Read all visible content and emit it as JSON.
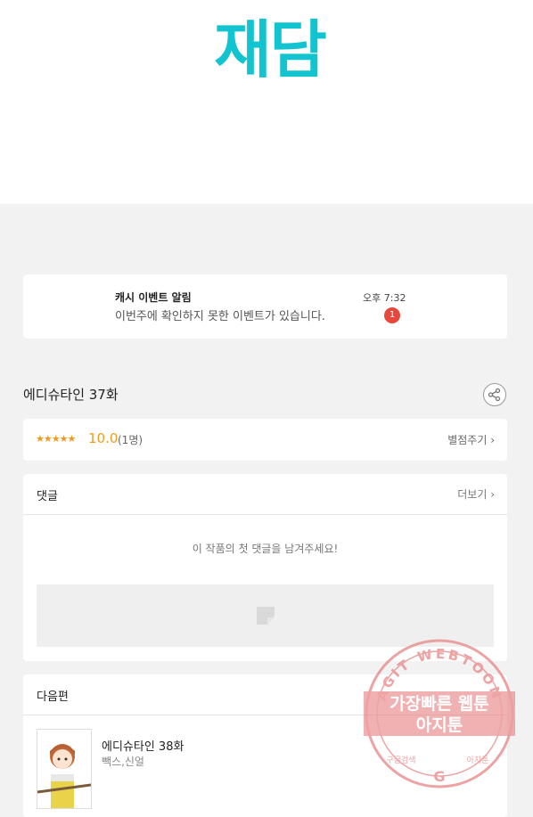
{
  "logo": {
    "text": "재담"
  },
  "notification": {
    "title": "캐시 이벤트 알림",
    "message": "이번주에 확인하지 못한 이벤트가 있습니다.",
    "time": "오후 7:32",
    "badge": "1"
  },
  "episode": {
    "title": "에디슈타인 37화",
    "share_icon": "share-icon"
  },
  "rating": {
    "stars": "★★★★★",
    "score": "10.0",
    "count": "(1명)",
    "rate_link": "별점주기 ›"
  },
  "comments": {
    "header": "댓글",
    "more": "더보기 ›",
    "empty_message": "이 작품의 첫 댓글을 남겨주세요!"
  },
  "next": {
    "header": "다음편",
    "title": "에디슈타인 38화",
    "authors": "빽스,신얼"
  },
  "watermark": {
    "arc_text": "AGIT WEBTOON",
    "line1": "가장빠른 웹툰",
    "line2": "아지툰",
    "bottom_left": "구글검색",
    "bottom_right": "아지툰"
  },
  "colors": {
    "brand": "#12c4cf",
    "star": "#f19a1a",
    "badge": "#e8483b",
    "watermark": "#e88a8a"
  }
}
